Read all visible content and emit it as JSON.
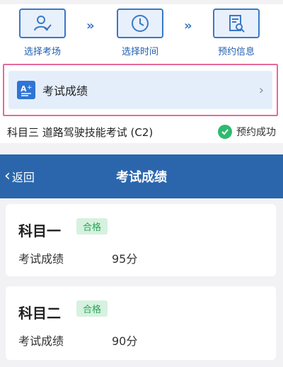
{
  "steps": [
    {
      "label": "选择考场",
      "icon": "user-check-icon"
    },
    {
      "label": "选择时间",
      "icon": "clock-icon"
    },
    {
      "label": "预约信息",
      "icon": "document-search-icon"
    }
  ],
  "step_separator": "»",
  "score_entry": {
    "label": "考试成绩",
    "icon": "grade-icon",
    "arrow": "›"
  },
  "exam": {
    "title": "科目三 道路驾驶技能考试 (C2)",
    "status": "预约成功"
  },
  "header": {
    "back_label": "返回",
    "title": "考试成绩",
    "bg_color": "#2b66ac"
  },
  "results": [
    {
      "subject": "科目一",
      "badge": "合格",
      "score_label": "考试成绩",
      "score": "95分"
    },
    {
      "subject": "科目二",
      "badge": "合格",
      "score_label": "考试成绩",
      "score": "90分"
    }
  ],
  "colors": {
    "accent": "#3a78c6",
    "pass": "#2dbb6e",
    "highlight_border": "#e56a9b"
  }
}
